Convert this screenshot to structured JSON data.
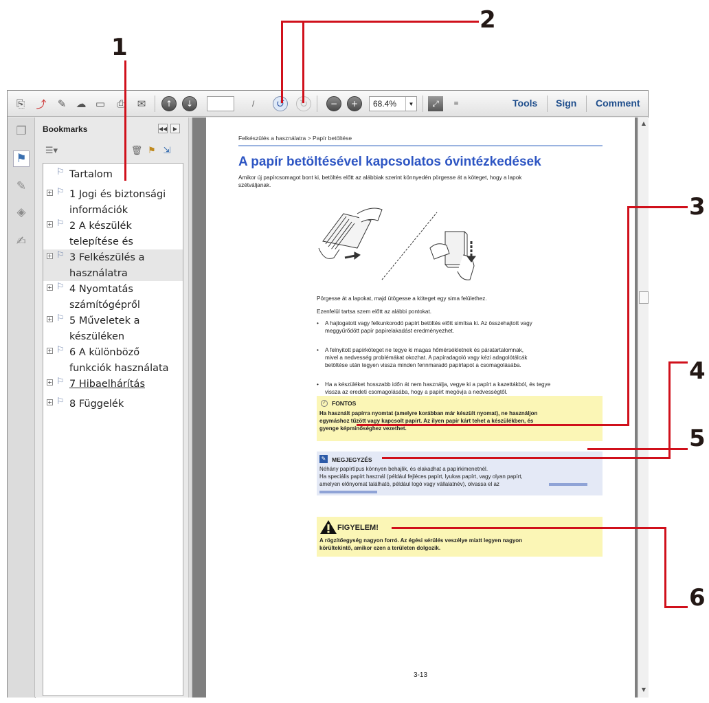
{
  "callouts": [
    "1",
    "2",
    "3",
    "4",
    "5",
    "6"
  ],
  "toolbar": {
    "page_total": "/",
    "zoom_value": "68.4%",
    "tools_label": "Tools",
    "sign_label": "Sign",
    "comment_label": "Comment"
  },
  "bookmarks": {
    "title": "Bookmarks",
    "items": [
      {
        "label": "Tartalom",
        "expandable": false,
        "selected": false,
        "link": false
      },
      {
        "label": "1 Jogi és biztonsági információk",
        "expandable": true,
        "selected": false,
        "link": false
      },
      {
        "label": "2 A készülék telepítése és beállítása",
        "expandable": true,
        "selected": false,
        "link": false
      },
      {
        "label": "3 Felkészülés a használatra",
        "expandable": true,
        "selected": true,
        "link": false
      },
      {
        "label": "4 Nyomtatás számítógépről",
        "expandable": true,
        "selected": false,
        "link": false
      },
      {
        "label": "5 Műveletek a készüléken",
        "expandable": true,
        "selected": false,
        "link": false
      },
      {
        "label": "6 A különböző funkciók használata",
        "expandable": true,
        "selected": false,
        "link": false
      },
      {
        "label": "7 Hibaelhárítás",
        "expandable": true,
        "selected": false,
        "link": true
      },
      {
        "label": "8 Függelék",
        "expandable": true,
        "selected": false,
        "link": false
      }
    ]
  },
  "page": {
    "breadcrumb": "Felkészülés a használatra > Papír betöltése",
    "title": "A papír betöltésével kapcsolatos óvintézkedések",
    "intro_line1": "Amikor új papírcsomagot bont ki, betöltés előtt az alábbiak szerint könnyedén pörgesse át a köteget, hogy a lapok",
    "intro_line2": "szétváljanak.",
    "after_image_1": "Pörgesse át a lapokat, majd ütögesse a köteget egy sima felülethez.",
    "after_image_2": "Ezenfelül tartsa szem előtt az alábbi pontokat.",
    "bullets": [
      [
        "A hajtogatott vagy felkunkorodó papírt betöltés előtt simítsa ki. Az összehajtott vagy",
        "meggyűrődött papír papírelakadást eredményezhet."
      ],
      [
        "A felnyitott papírköteget ne tegye ki magas hőmérsékletnek és páratartalomnak,",
        "mivel a nedvesség problémákat okozhat. A papíradagoló vagy kézi adagolótálcák",
        "betöltése után tegyen vissza minden fennmaradó papírlapot a csomagolásába."
      ],
      [
        "Ha a készüléket hosszabb időn át nem használja, vegye ki a papírt a kazettákból, és tegye",
        "vissza az eredeti csomagolásába, hogy a papírt megóvja a nedvességtől."
      ]
    ],
    "fontos": {
      "head": "FONTOS",
      "lines": [
        "Ha használt papírra nyomtat (amelyre korábban már készült nyomat), ne használjon",
        "egymáshoz tűzött vagy kapcsolt papírt. Az ilyen papír kárt tehet a készülékben, és",
        "gyenge képminőséghez vezethet."
      ]
    },
    "megjegyzes": {
      "head": "MEGJEGYZÉS",
      "lines": [
        "Néhány papírtípus könnyen behajlik, és elakadhat a papírkimenetnél.",
        "Ha speciális papírt használ (például fejléces papírt, lyukas papírt, vagy olyan papírt,",
        "amelyen előnyomat található, például logó vagy vállalatnév), olvassa el az"
      ]
    },
    "figyelem": {
      "head": "FIGYELEM!",
      "lines": [
        "A rögzítőegység nagyon forró. Az égési sérülés veszélye miatt legyen nagyon",
        "körültekintő, amikor ezen a területen dolgozik."
      ]
    },
    "page_number": "3-13"
  },
  "colors": {
    "accent_red": "#d0101b",
    "title_blue": "#2d55c3",
    "toolbar_text": "#1f4e8c",
    "fontos_bg": "#fbf6b6",
    "megjegyzes_bg": "#e4e9f6"
  }
}
